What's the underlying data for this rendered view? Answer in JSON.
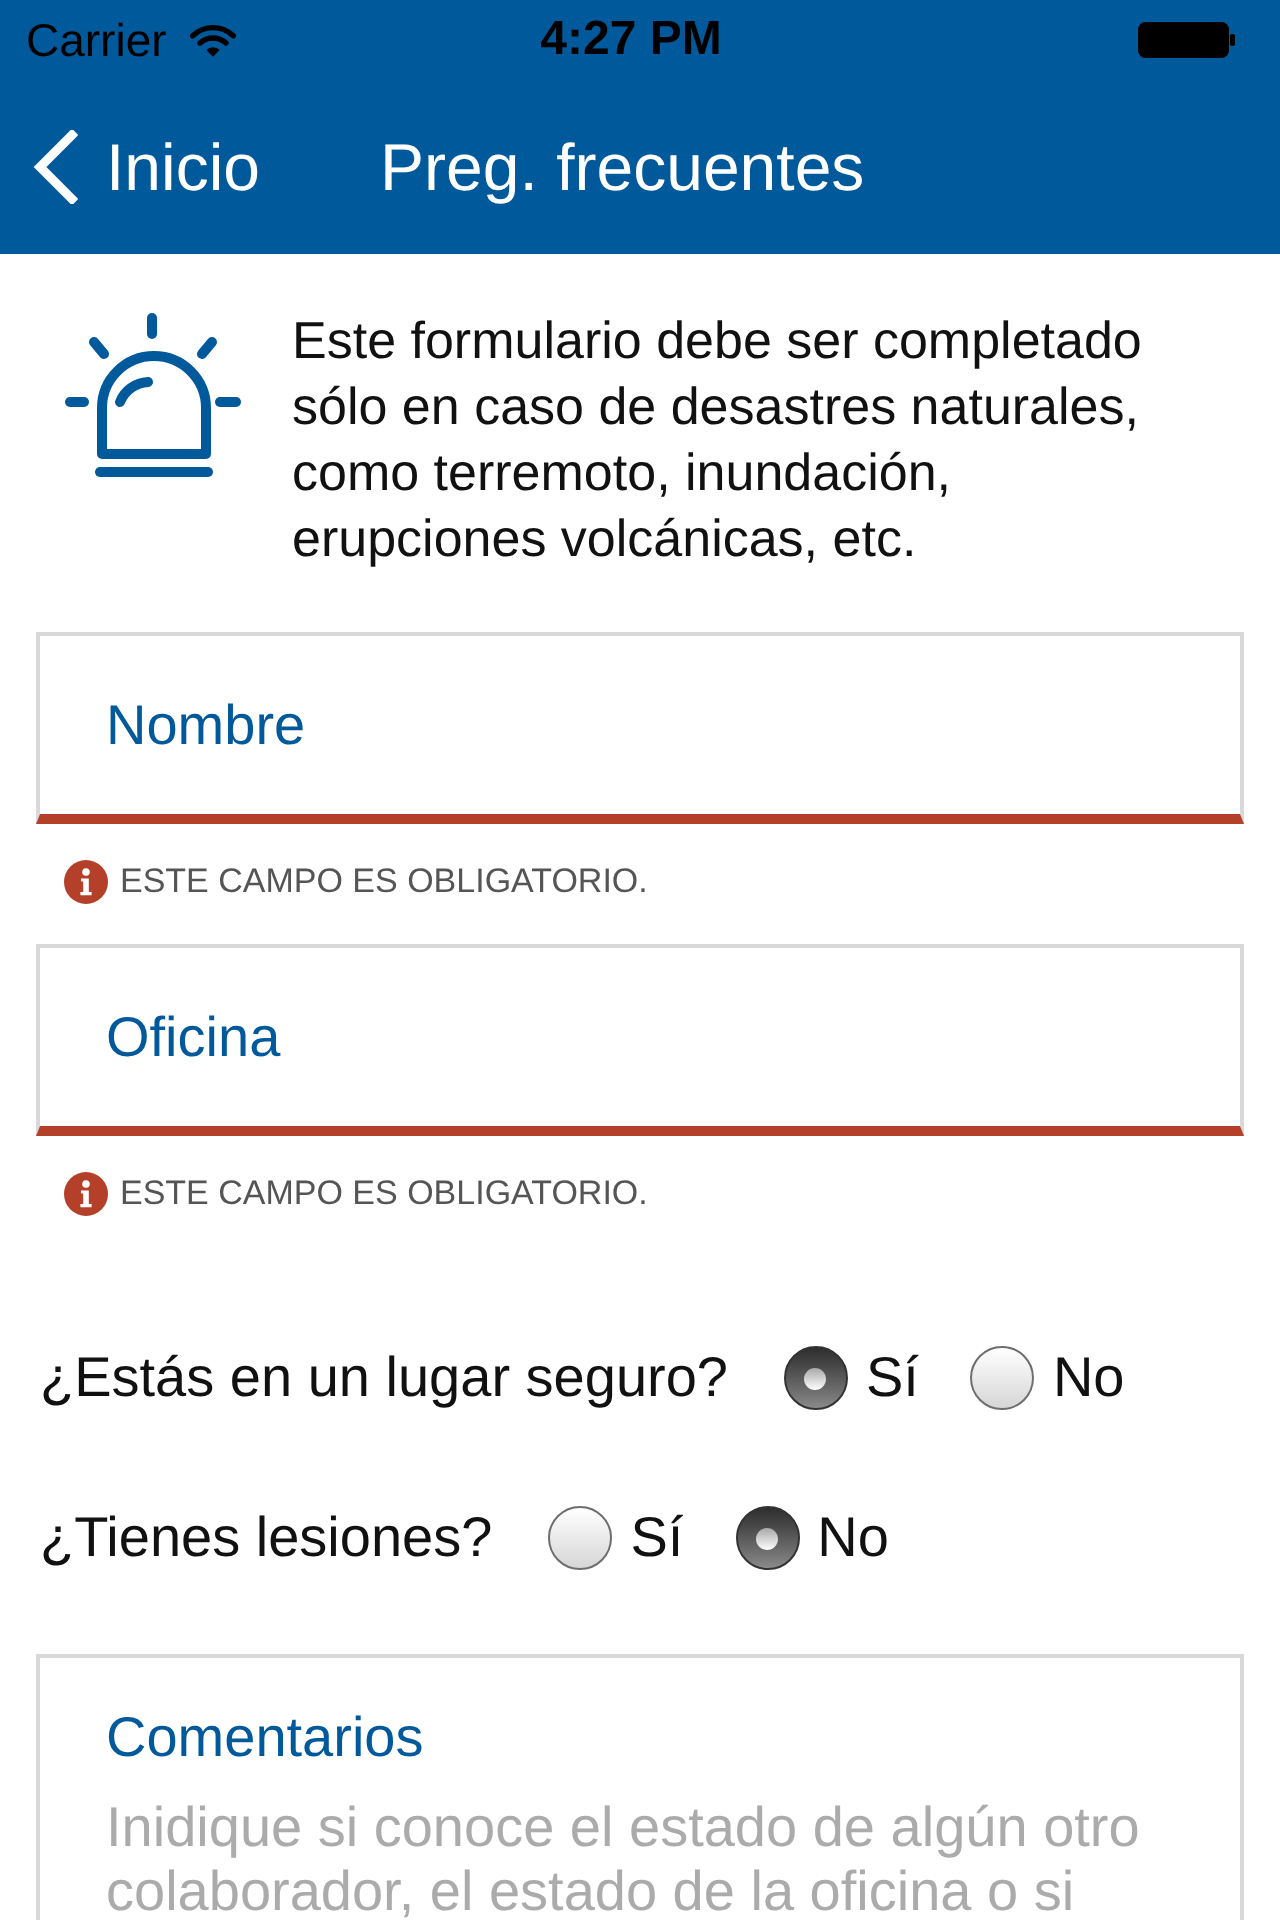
{
  "status_bar": {
    "carrier": "Carrier",
    "time": "4:27 PM"
  },
  "nav_bar": {
    "back_label": "Inicio",
    "title": "Preg. frecuentes"
  },
  "intro": {
    "text": "Este formulario debe ser completado sólo en caso de desastres naturales, como terremoto, inundación, erupciones volcánicas, etc."
  },
  "fields": [
    {
      "label": "Nombre",
      "invalid": true,
      "error": "ESTE CAMPO ES OBLIGATORIO."
    },
    {
      "label": "Oficina",
      "invalid": true,
      "error": "ESTE CAMPO ES OBLIGATORIO."
    }
  ],
  "questions": [
    {
      "label": "¿Estás en un lugar seguro?",
      "options": [
        {
          "label": "Sí",
          "selected": true
        },
        {
          "label": "No",
          "selected": false
        }
      ]
    },
    {
      "label": "¿Tienes lesiones?",
      "options": [
        {
          "label": "Sí",
          "selected": false
        },
        {
          "label": "No",
          "selected": true
        }
      ]
    }
  ],
  "comments": {
    "label": "Comentarios",
    "placeholder": "Inidique si conoce el estado de algún otro colaborador, el estado de la oficina o si"
  }
}
